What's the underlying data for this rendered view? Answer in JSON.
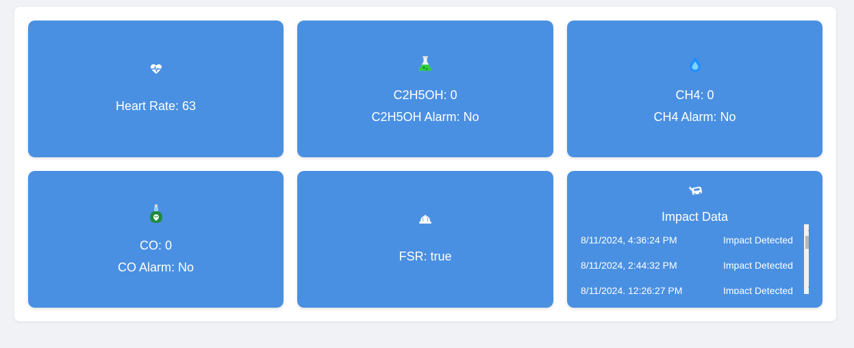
{
  "cards": {
    "heart_rate": {
      "icon": "heart-pulse-icon",
      "label": "Heart Rate: 63"
    },
    "c2h5oh": {
      "icon": "flask-icon",
      "value_label": "C2H5OH: 0",
      "alarm_label": "C2H5OH Alarm: No"
    },
    "ch4": {
      "icon": "droplet-icon",
      "value_label": "CH4: 0",
      "alarm_label": "CH4 Alarm: No"
    },
    "co": {
      "icon": "poison-bottle-icon",
      "value_label": "CO: 0",
      "alarm_label": "CO Alarm: No"
    },
    "fsr": {
      "icon": "hard-hat-icon",
      "label": "FSR: true"
    },
    "impact": {
      "icon": "car-crash-icon",
      "title": "Impact Data",
      "entries": [
        {
          "time": "8/11/2024, 4:36:24 PM",
          "status": "Impact Detected"
        },
        {
          "time": "8/11/2024, 2:44:32 PM",
          "status": "Impact Detected"
        },
        {
          "time": "8/11/2024, 12:26:27 PM",
          "status": "Impact Detected"
        }
      ]
    }
  },
  "colors": {
    "page_background": "#f0f2f5",
    "panel_background": "#ffffff",
    "card_background": "#4a90e2",
    "card_text": "#ffffff",
    "flask_liquid": "#2ecc40",
    "droplet": "#1e90ff",
    "poison_bottle": "#1f8a3b"
  }
}
